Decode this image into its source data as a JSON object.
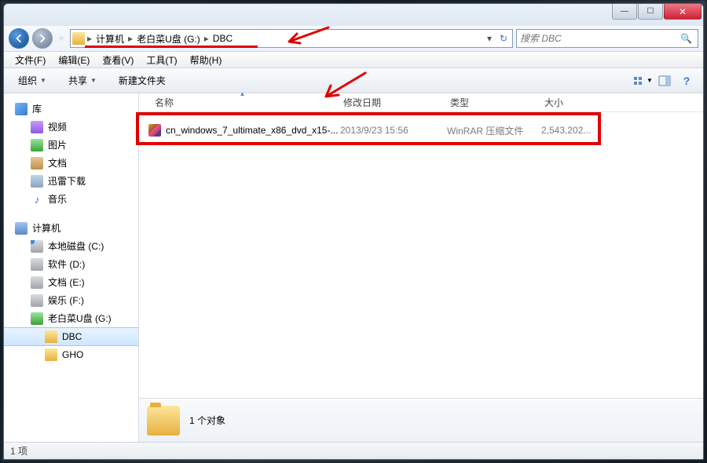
{
  "window": {
    "controls": {
      "min": "—",
      "max": "☐",
      "close": "✕"
    }
  },
  "addressbar": {
    "parts": [
      "计算机",
      "老白菜U盘 (G:)",
      "DBC"
    ]
  },
  "search": {
    "placeholder": "搜索 DBC"
  },
  "menubar": {
    "file": "文件(F)",
    "edit": "编辑(E)",
    "view": "查看(V)",
    "tools": "工具(T)",
    "help": "帮助(H)"
  },
  "toolbar": {
    "organize": "组织",
    "share": "共享",
    "new_folder": "新建文件夹"
  },
  "sidebar": {
    "libraries": {
      "label": "库",
      "items": [
        {
          "label": "视频",
          "icon": "i-vid"
        },
        {
          "label": "图片",
          "icon": "i-pic"
        },
        {
          "label": "文档",
          "icon": "i-doc"
        },
        {
          "label": "迅雷下载",
          "icon": "i-dl"
        },
        {
          "label": "音乐",
          "icon": "i-music",
          "glyph": "♪"
        }
      ]
    },
    "computer": {
      "label": "计算机",
      "items": [
        {
          "label": "本地磁盘 (C:)",
          "icon": "i-disk c"
        },
        {
          "label": "软件 (D:)",
          "icon": "i-disk"
        },
        {
          "label": "文档 (E:)",
          "icon": "i-disk"
        },
        {
          "label": "娱乐 (F:)",
          "icon": "i-disk"
        },
        {
          "label": "老白菜U盘 (G:)",
          "icon": "i-usb"
        }
      ],
      "sub": [
        {
          "label": "DBC",
          "selected": true
        },
        {
          "label": "GHO",
          "selected": false
        }
      ]
    }
  },
  "columns": {
    "name": "名称",
    "date": "修改日期",
    "type": "类型",
    "size": "大小"
  },
  "files": [
    {
      "name": "cn_windows_7_ultimate_x86_dvd_x15-...",
      "date": "2013/9/23 15:56",
      "type": "WinRAR 压缩文件",
      "size": "2,543,202..."
    }
  ],
  "details": {
    "count": "1 个对象"
  },
  "statusbar": {
    "text": "1 项"
  }
}
